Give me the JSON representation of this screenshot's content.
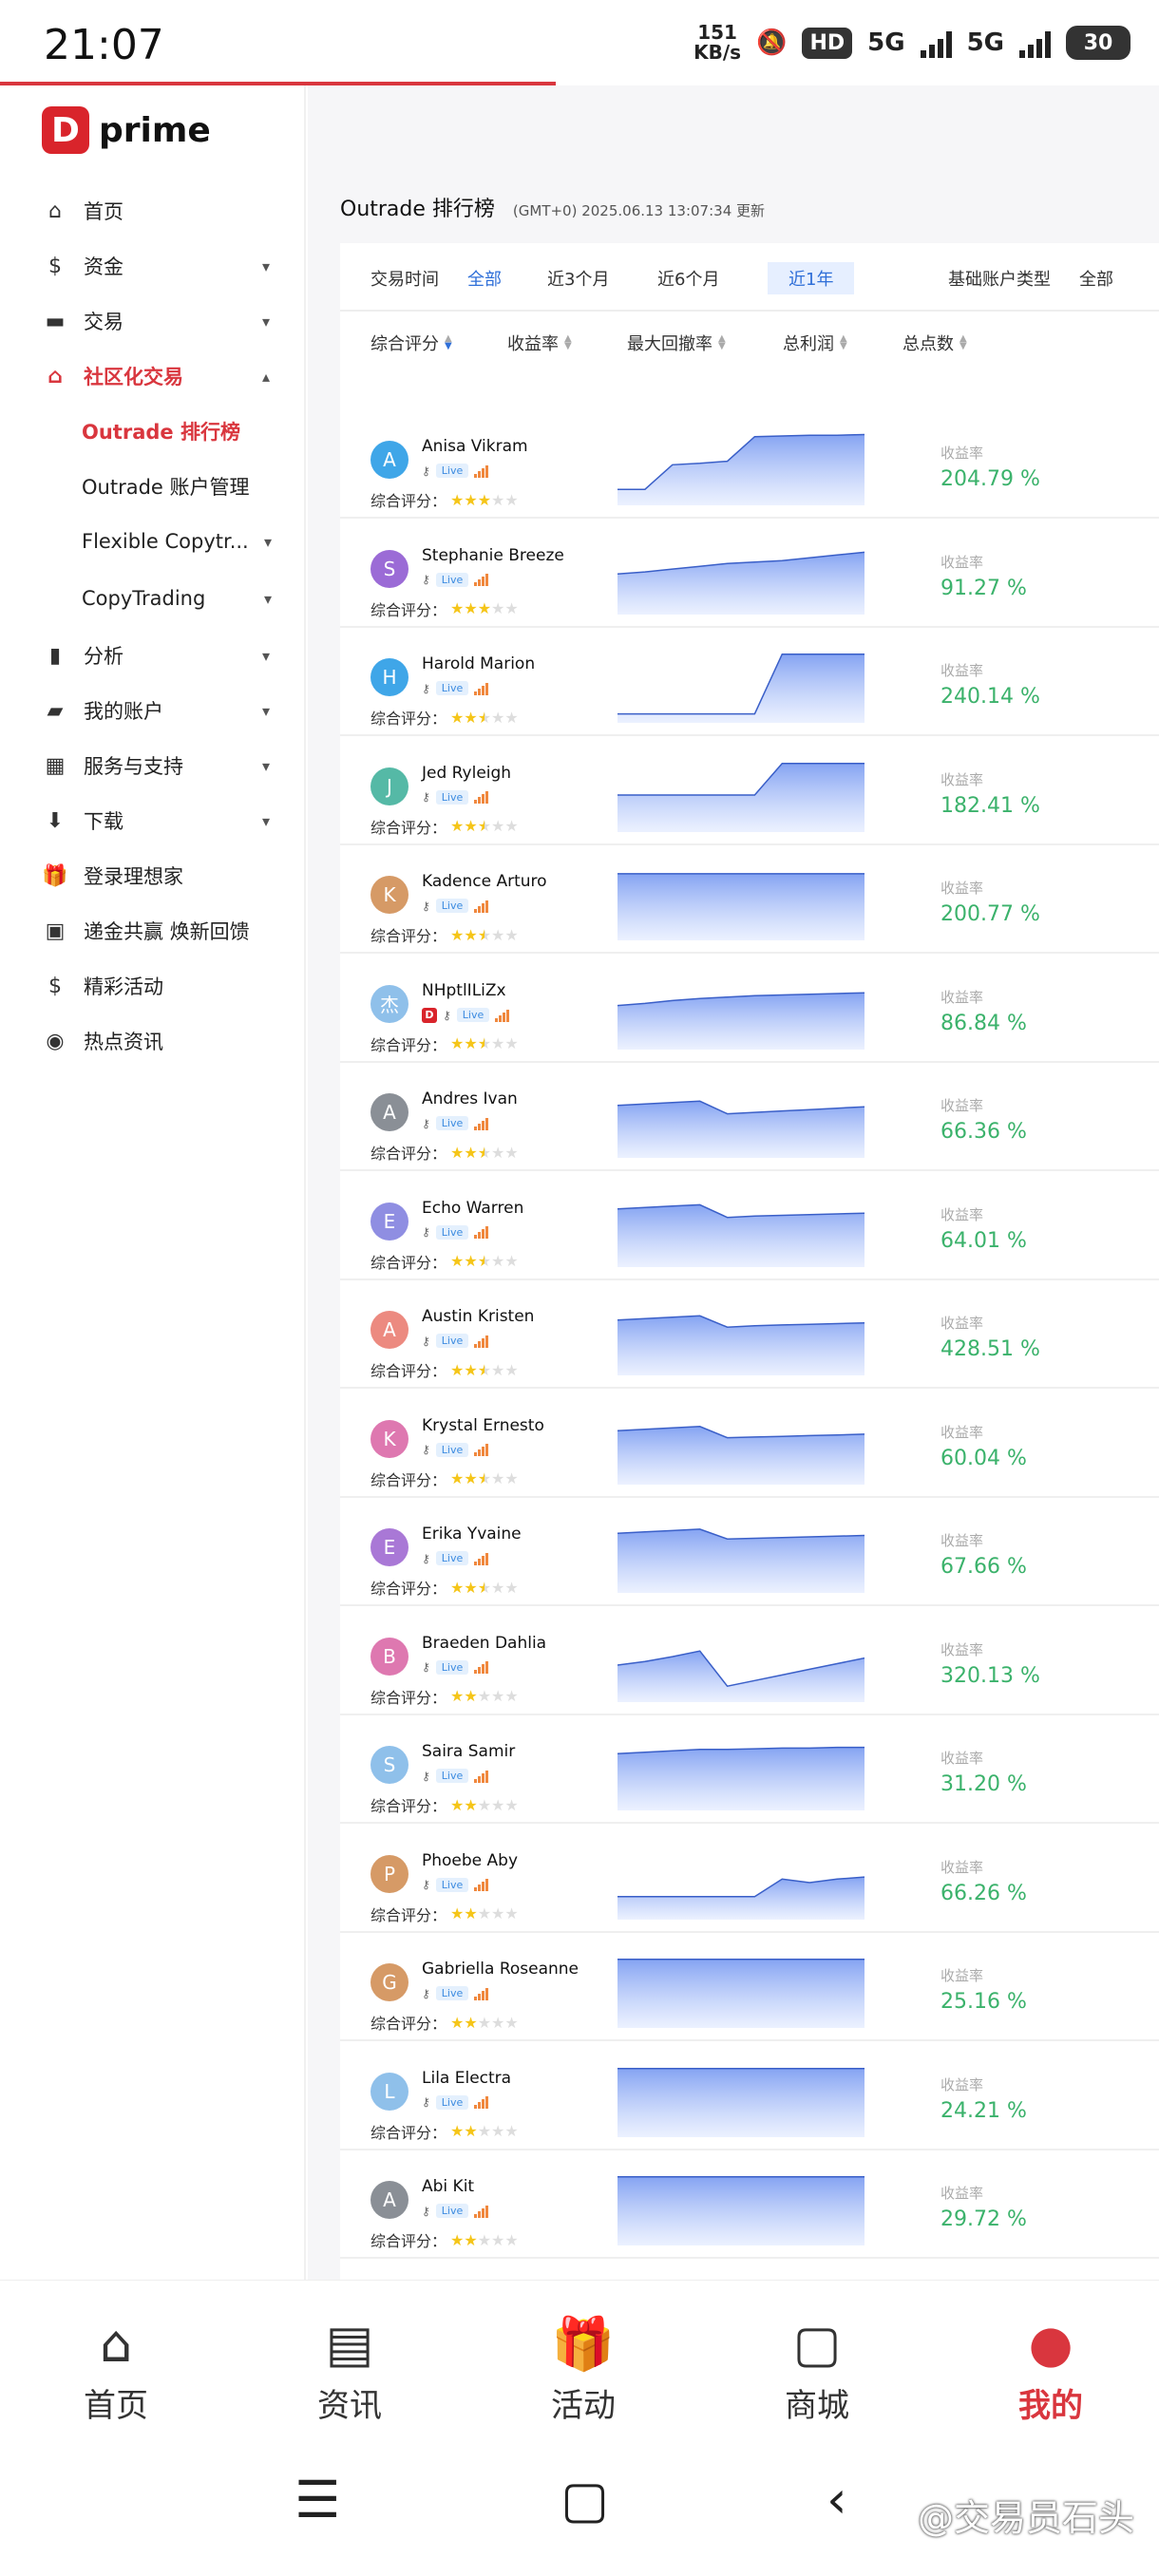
{
  "status": {
    "time": "21:07",
    "net_speed_value": "151",
    "net_speed_unit": "KB/s",
    "hd": "HD",
    "net1": "5G",
    "net2": "5G",
    "battery": "30"
  },
  "brand": {
    "logo_letter": "D",
    "name": "prime"
  },
  "sidebar": {
    "items": [
      {
        "label": "首页",
        "icon": "home-icon"
      },
      {
        "label": "资金",
        "icon": "dollar-icon"
      },
      {
        "label": "交易",
        "icon": "card-icon"
      },
      {
        "label": "社区化交易",
        "icon": "community-icon"
      },
      {
        "label": "分析",
        "icon": "bar-chart-icon"
      },
      {
        "label": "我的账户",
        "icon": "folder-icon"
      },
      {
        "label": "服务与支持",
        "icon": "grid-icon"
      },
      {
        "label": "下载",
        "icon": "download-icon"
      },
      {
        "label": "登录理想家",
        "icon": "gift-icon"
      },
      {
        "label": "递金共赢 焕新回馈",
        "icon": "wallet-icon"
      },
      {
        "label": "精彩活动",
        "icon": "activity-icon"
      },
      {
        "label": "热点资讯",
        "icon": "news-icon"
      }
    ],
    "subitems": [
      {
        "label": "Outrade 排行榜"
      },
      {
        "label": "Outrade 账户管理"
      },
      {
        "label": "Flexible Copytr..."
      },
      {
        "label": "CopyTrading"
      }
    ]
  },
  "page": {
    "title": "Outrade 排行榜",
    "updated": "(GMT+0) 2025.06.13 13:07:34 更新"
  },
  "filters": {
    "time_label": "交易时间",
    "time_options": [
      "全部",
      "近3个月",
      "近6个月",
      "近1年"
    ],
    "account_label": "基础账户类型",
    "account_value": "全部",
    "sort_columns": [
      "综合评分",
      "收益率",
      "最大回撤率",
      "总利润",
      "总点数"
    ]
  },
  "list": {
    "return_label": "收益率",
    "rating_label": "综合评分：",
    "live_label": "Live",
    "traders": [
      {
        "initial": "A",
        "name": "Anisa Vikram",
        "color": "#3fa6e8",
        "stars": 3,
        "return": "204.79 %",
        "curve": [
          0.2,
          0.2,
          0.55,
          0.57,
          0.6,
          0.95,
          0.96,
          0.97,
          0.97,
          0.98
        ]
      },
      {
        "initial": "S",
        "name": "Stephanie Breeze",
        "color": "#9b6bd6",
        "stars": 3,
        "return": "91.27 %",
        "curve": [
          0.55,
          0.58,
          0.62,
          0.66,
          0.7,
          0.72,
          0.74,
          0.78,
          0.82,
          0.86
        ]
      },
      {
        "initial": "H",
        "name": "Harold Marion",
        "color": "#3fa6e8",
        "stars": 2.5,
        "return": "240.14 %",
        "curve": [
          0.1,
          0.1,
          0.1,
          0.1,
          0.1,
          0.1,
          0.95,
          0.95,
          0.95,
          0.95
        ]
      },
      {
        "initial": "J",
        "name": "Jed Ryleigh",
        "color": "#55b9a6",
        "stars": 2.5,
        "return": "182.41 %",
        "curve": [
          0.5,
          0.5,
          0.5,
          0.5,
          0.5,
          0.5,
          0.95,
          0.95,
          0.95,
          0.95
        ]
      },
      {
        "initial": "K",
        "name": "Kadence Arturo",
        "color": "#d69a66",
        "stars": 2.5,
        "return": "200.77 %",
        "curve": [
          0.92,
          0.92,
          0.92,
          0.92,
          0.92,
          0.92,
          0.92,
          0.92,
          0.92,
          0.92
        ]
      },
      {
        "initial": "杰",
        "name": "NHptlILiZx",
        "color": "#8fc0ea",
        "stars": 2.5,
        "return": "86.84 %",
        "curve": [
          0.6,
          0.63,
          0.67,
          0.7,
          0.72,
          0.74,
          0.75,
          0.76,
          0.77,
          0.78
        ]
      },
      {
        "initial": "A",
        "name": "Andres Ivan",
        "color": "#8a8f96",
        "stars": 2.5,
        "return": "66.36 %",
        "curve": [
          0.72,
          0.74,
          0.76,
          0.78,
          0.6,
          0.62,
          0.64,
          0.66,
          0.68,
          0.7
        ]
      },
      {
        "initial": "E",
        "name": "Echo Warren",
        "color": "#8f8ee2",
        "stars": 2.5,
        "return": "64.01 %",
        "curve": [
          0.8,
          0.82,
          0.84,
          0.86,
          0.68,
          0.7,
          0.71,
          0.72,
          0.73,
          0.74
        ]
      },
      {
        "initial": "A",
        "name": "Austin Kristen",
        "color": "#ec8a80",
        "stars": 2.5,
        "return": "428.51 %",
        "curve": [
          0.76,
          0.78,
          0.8,
          0.82,
          0.66,
          0.68,
          0.69,
          0.7,
          0.71,
          0.72
        ]
      },
      {
        "initial": "K",
        "name": "Krystal Ernesto",
        "color": "#de78b0",
        "stars": 2.5,
        "return": "60.04 %",
        "curve": [
          0.74,
          0.76,
          0.78,
          0.8,
          0.64,
          0.65,
          0.66,
          0.67,
          0.68,
          0.69
        ]
      },
      {
        "initial": "E",
        "name": "Erika Yvaine",
        "color": "#a978d6",
        "stars": 2.5,
        "return": "67.66 %",
        "curve": [
          0.82,
          0.84,
          0.86,
          0.88,
          0.74,
          0.75,
          0.76,
          0.77,
          0.78,
          0.79
        ]
      },
      {
        "initial": "B",
        "name": "Braeden Dahlia",
        "color": "#de78b0",
        "stars": 2,
        "return": "320.13 %",
        "curve": [
          0.5,
          0.55,
          0.62,
          0.7,
          0.2,
          0.28,
          0.36,
          0.44,
          0.52,
          0.6
        ]
      },
      {
        "initial": "S",
        "name": "Saira Samir",
        "color": "#8fc0ea",
        "stars": 2,
        "return": "31.20 %",
        "curve": [
          0.78,
          0.8,
          0.82,
          0.84,
          0.84,
          0.85,
          0.86,
          0.86,
          0.87,
          0.87
        ]
      },
      {
        "initial": "P",
        "name": "Phoebe Aby",
        "color": "#d69a66",
        "stars": 2,
        "return": "66.26 %",
        "curve": [
          0.3,
          0.3,
          0.3,
          0.3,
          0.3,
          0.3,
          0.55,
          0.5,
          0.55,
          0.58
        ]
      },
      {
        "initial": "G",
        "name": "Gabriella Roseanne",
        "color": "#d69a66",
        "stars": 2,
        "return": "25.16 %",
        "curve": [
          0.95,
          0.95,
          0.95,
          0.95,
          0.95,
          0.95,
          0.95,
          0.95,
          0.95,
          0.95
        ]
      },
      {
        "initial": "L",
        "name": "Lila Electra",
        "color": "#8fc0ea",
        "stars": 2,
        "return": "24.21 %",
        "curve": [
          0.95,
          0.95,
          0.95,
          0.95,
          0.95,
          0.95,
          0.95,
          0.95,
          0.95,
          0.95
        ]
      },
      {
        "initial": "A",
        "name": "Abi Kit",
        "color": "#8a8f96",
        "stars": 2,
        "return": "29.72 %",
        "curve": [
          0.95,
          0.95,
          0.95,
          0.95,
          0.95,
          0.95,
          0.95,
          0.95,
          0.95,
          0.95
        ]
      }
    ]
  },
  "bottom_nav": [
    {
      "label": "首页",
      "icon": "home-icon"
    },
    {
      "label": "资讯",
      "icon": "news-icon"
    },
    {
      "label": "活动",
      "icon": "gift-icon"
    },
    {
      "label": "商城",
      "icon": "shop-icon"
    },
    {
      "label": "我的",
      "icon": "profile-icon"
    }
  ],
  "watermark": "@交易员石头",
  "colors": {
    "accent": "#d9363e",
    "link": "#2f6fd8",
    "positive": "#3bb26b"
  }
}
